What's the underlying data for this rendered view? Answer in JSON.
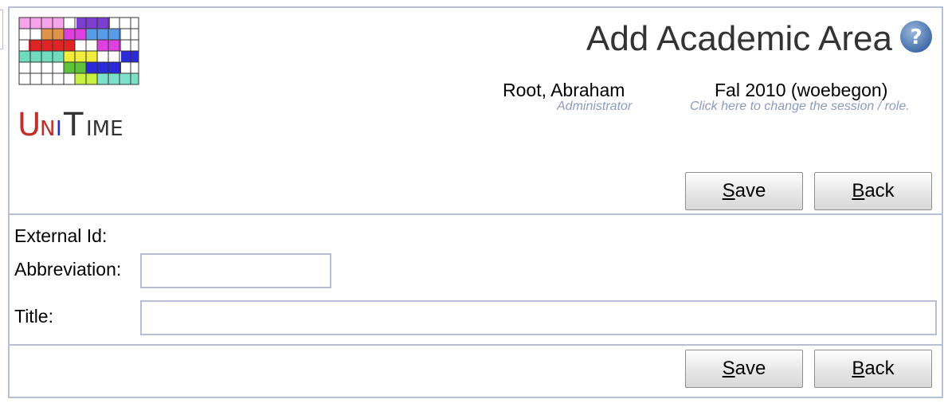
{
  "header": {
    "logo_text": "UniTime",
    "title": "Add Academic Area",
    "help_icon": "question-mark-icon",
    "user": {
      "name": "Root, Abraham",
      "role": "Administrator"
    },
    "session": {
      "name": "Fal 2010 (woebegon)",
      "hint": "Click here to change the session / role."
    }
  },
  "toolbar_top": {
    "save": {
      "underlined": "S",
      "rest": "ave"
    },
    "back": {
      "underlined": "B",
      "rest": "ack"
    }
  },
  "form": {
    "external_id_label": "External Id:",
    "abbreviation_label": "Abbreviation:",
    "abbreviation_value": "",
    "title_label": "Title:",
    "title_value": ""
  },
  "toolbar_bottom": {
    "save": {
      "underlined": "S",
      "rest": "ave"
    },
    "back": {
      "underlined": "B",
      "rest": "ack"
    }
  },
  "colors": {
    "border": "#b7c0d6",
    "hint_text": "#8c9ac0",
    "title_text": "#333333"
  }
}
